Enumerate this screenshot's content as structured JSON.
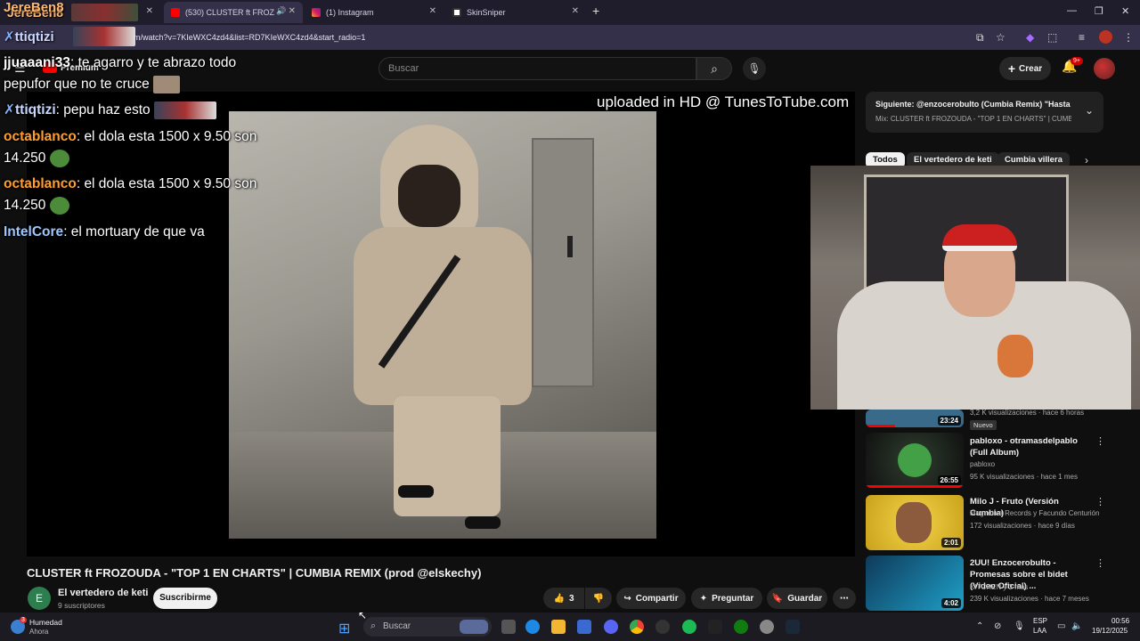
{
  "browser": {
    "tabs": [
      {
        "label": "JereBen8",
        "active": false
      },
      {
        "label": "(530) CLUSTER ft FROZOUDA",
        "active": true
      },
      {
        "label": "(1) Instagram",
        "active": false
      },
      {
        "label": "SkinSniper",
        "active": false
      }
    ],
    "url": "m/watch?v=7KIeWXC4zd4&list=RD7KIeWXC4zd4&start_radio=1"
  },
  "youtube": {
    "premium_label": "Premium",
    "search_placeholder": "Buscar",
    "create_label": "Crear",
    "notif_badge": "9+"
  },
  "chat": [
    {
      "user": "jjuaaani33",
      "text": ": te agarro y te abrazo todo",
      "color": "#ffffff"
    },
    {
      "user": "",
      "text": "pepufor que no te cruce",
      "color": "#ffffff"
    },
    {
      "user": "ttiqtizi",
      "text": ": pepu haz esto",
      "color": "#c9d7ff"
    },
    {
      "user": "octablanco",
      "text": ": el dola esta 1500 x 9.50 son",
      "color": "#ff9e2c"
    },
    {
      "user": "",
      "text": "14.250",
      "color": "#ffffff"
    },
    {
      "user": "octablanco",
      "text": ": el dola esta 1500 x 9.50 son",
      "color": "#ff9e2c"
    },
    {
      "user": "",
      "text": "14.250",
      "color": "#ffffff"
    },
    {
      "user": "IntelCore",
      "text": ": el mortuary de que va",
      "color": "#9ec7ff"
    }
  ],
  "chat_top_user": "ttiqtizi",
  "chat_top_tab": "JereBen8",
  "player": {
    "watermark": "uploaded in HD @ TunesToTube.com"
  },
  "video": {
    "title": "CLUSTER ft FROZOUDA - \"TOP 1 EN CHARTS\" | CUMBIA REMIX (prod @elskechy)",
    "channel_initial": "E",
    "channel": "El vertedero de keti",
    "subscribers": "9 suscriptores",
    "subscribe_label": "Suscribirme",
    "likes": "3",
    "share_label": "Compartir",
    "ask_label": "Preguntar",
    "save_label": "Guardar"
  },
  "next_up": {
    "title": "Siguiente: @enzocerobulto (Cumbia Remix) \"Hasta ...",
    "subtitle": "Mix: CLUSTER ft FROZOUDA - \"TOP 1 EN CHARTS\" | CUMBIA..."
  },
  "chips": [
    "Todos",
    "El vertedero de keti",
    "Cumbia villera"
  ],
  "recommendations": [
    {
      "duration": "23:24",
      "meta": "3,2 K visualizaciones · hace 6 horas",
      "badge": "Nuevo"
    },
    {
      "title": "pabloxo - otramasdelpablo (Full Album)",
      "channel": "pabloxo",
      "meta": "95 K visualizaciones · hace 1 mes",
      "duration": "26:55"
    },
    {
      "title": "Milo J -  Fruto (Versión Cumbia)",
      "channel": "Magnetica Records y Facundo Centurión",
      "meta": "172 visualizaciones · hace 9 días",
      "duration": "2:01"
    },
    {
      "title": "2UU! Enzocerobulto - Promesas sobre el bidet (Video Oficial) ...",
      "channel": "KITCHEN y 2 más",
      "meta": "239 K visualizaciones · hace 7 meses",
      "duration": "4:02"
    }
  ],
  "taskbar": {
    "weather_title": "Humedad",
    "weather_sub": "Ahora",
    "weather_badge": "3",
    "search_placeholder": "Buscar",
    "lang": "ESP",
    "lang_sub": "LAA",
    "time": "00:56",
    "date": "19/12/2025"
  }
}
